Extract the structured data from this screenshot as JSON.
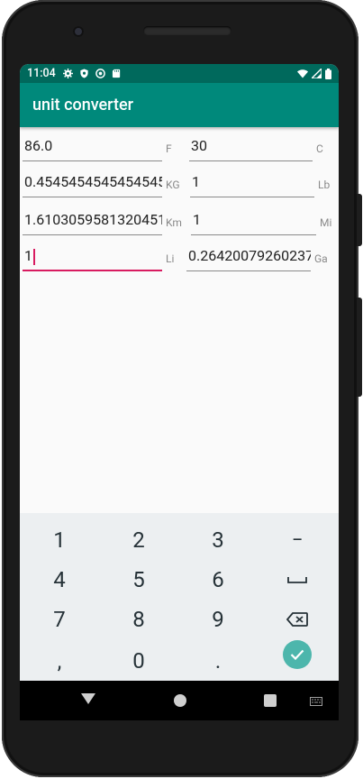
{
  "status": {
    "time": "11:04",
    "icons": [
      "gear-icon",
      "shield-icon",
      "sync-icon",
      "sdcard-icon"
    ],
    "right_icons": [
      "wifi-icon",
      "cell-signal-icon",
      "battery-icon"
    ]
  },
  "app": {
    "title": "unit converter"
  },
  "rows": [
    {
      "left_value": "86.0",
      "left_unit": "F",
      "right_value": "30",
      "right_unit": "C"
    },
    {
      "left_value": "0.45454545454545454",
      "left_unit": "KG",
      "right_value": "1",
      "right_unit": "Lb"
    },
    {
      "left_value": "1.6103059581320451",
      "left_unit": "Km",
      "right_value": "1",
      "right_unit": "Mi"
    },
    {
      "left_value": "1",
      "left_unit": "Li",
      "right_value": "0.26420079260237",
      "right_unit": "Ga"
    }
  ],
  "keyboard": {
    "keys": [
      "1",
      "2",
      "3",
      "−",
      "4",
      "5",
      "6",
      "␣",
      "7",
      "8",
      "9",
      "⌫",
      ",",
      "0",
      ".",
      "✓"
    ],
    "accent": "#4db6ac"
  },
  "colors": {
    "statusbar": "#00695c",
    "appbar": "#00897b",
    "focus": "#d81b60"
  }
}
